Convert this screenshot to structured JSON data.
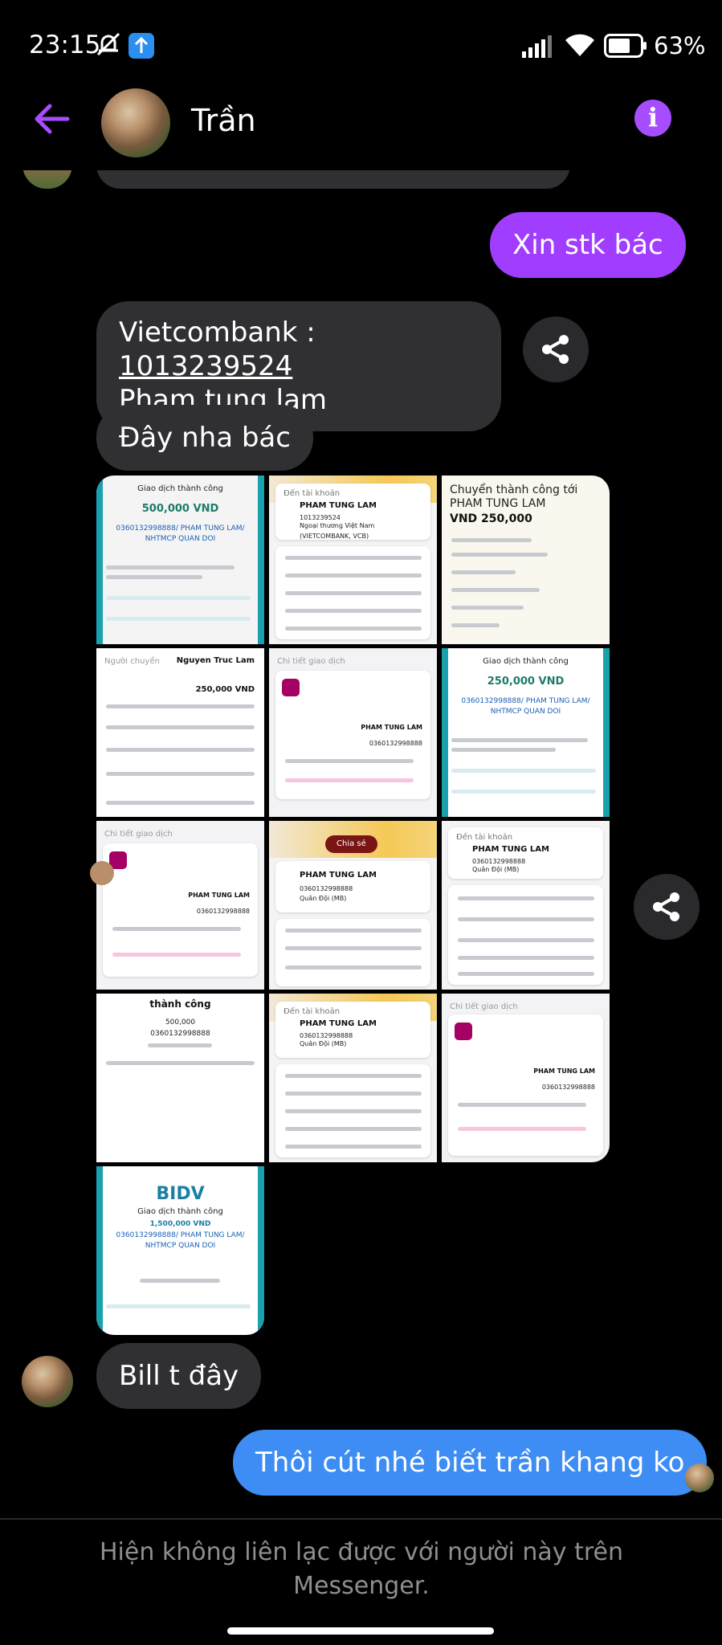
{
  "status_bar": {
    "time": "23:15",
    "battery_percent": "63%"
  },
  "header": {
    "contact_name": "Trần"
  },
  "messages": {
    "sent_1": "Xin stk bác",
    "received_bank_prefix": "Vietcombank : ",
    "received_bank_account": "1013239524",
    "received_bank_name": "Pham tung lam",
    "received_2": "Đây nha bác",
    "received_3": "Bill t đây",
    "sent_2": "Thôi cút nhé biết trần khang ko"
  },
  "receipts": [
    {
      "title": "Giao dịch thành công",
      "amount": "500,000 VND",
      "account": "0360132998888/ PHAM TUNG LAM/ NHTMCP QUAN DOI"
    },
    {
      "title": "Đến tài khoản",
      "name": "PHAM TUNG LAM",
      "account": "1013239524",
      "bank": "Ngoại thương Việt Nam (VIETCOMBANK, VCB)"
    },
    {
      "title": "Chuyển thành công tới PHAM TUNG LAM",
      "amount": "VND 250,000"
    },
    {
      "title": "Người chuyển",
      "name": "Nguyen Truc Lam",
      "amount": "250,000 VND"
    },
    {
      "title": "Chi tiết giao dịch",
      "name": "PHAM TUNG LAM",
      "account": "0360132998888"
    },
    {
      "title": "Giao dịch thành công",
      "amount": "250,000 VND",
      "account": "0360132998888/ PHAM TUNG LAM/ NHTMCP QUAN DOI"
    },
    {
      "title": "Chi tiết giao dịch",
      "name": "PHAM TUNG LAM",
      "account": "0360132998888"
    },
    {
      "title": "Chia sẻ",
      "name": "PHAM TUNG LAM",
      "account": "0360132998888",
      "bank": "Quân Đội (MB)"
    },
    {
      "title": "Đến tài khoản",
      "name": "PHAM TUNG LAM",
      "account": "0360132998888",
      "bank": "Quân Đội (MB)"
    },
    {
      "title": "thành công",
      "amount": "500,000",
      "account": "0360132998888"
    },
    {
      "title": "Đến tài khoản",
      "name": "PHAM TUNG LAM",
      "account": "0360132998888",
      "bank": "Quân Đội (MB)"
    },
    {
      "title": "Chi tiết giao dịch",
      "name": "PHAM TUNG LAM",
      "account": "0360132998888"
    },
    {
      "title": "Giao dịch thành công",
      "amount": "1,500,000 VND",
      "account": "0360132998888/ PHAM TUNG LAM/ NHTMCP QUAN DOI",
      "brand": "BIDV"
    }
  ],
  "footer": {
    "notice": "Hiện không liên lạc được với người này trên Messenger."
  },
  "colors": {
    "outgoing_bubble": "#a13dff",
    "outgoing_bubble_alt": "#3d8df5",
    "incoming_bubble": "#303033",
    "accent": "#a64dff"
  }
}
